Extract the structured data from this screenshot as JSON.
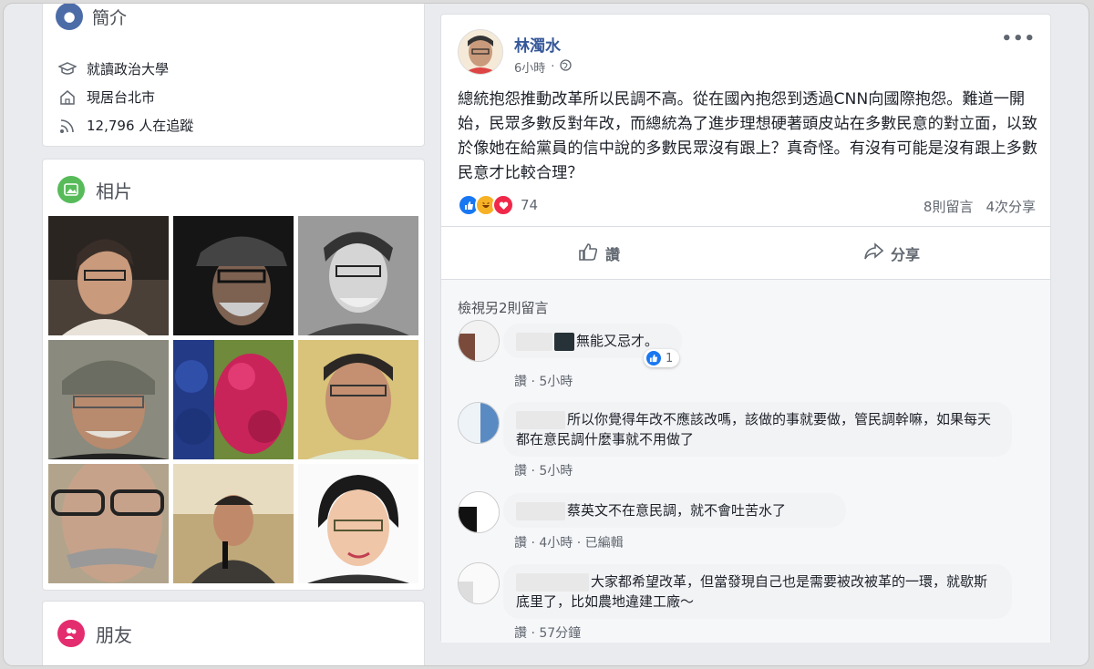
{
  "intro": {
    "title": "簡介",
    "education": "就讀政治大學",
    "residence": "現居台北市",
    "followers": "12,796 人在追蹤"
  },
  "photos": {
    "title": "相片"
  },
  "friends": {
    "title": "朋友"
  },
  "post": {
    "author": "林濁水",
    "time": "6小時",
    "text": "總統抱怨推動改革所以民調不高。從在國內抱怨到透過CNN向國際抱怨。難道一開始，民眾多數反對年改，而總統為了進步理想硬著頭皮站在多數民意的對立面，以致於像她在給黨員的信中說的多數民眾沒有跟上？真奇怪。有沒有可能是沒有跟上多數民意才比較合理？",
    "reaction_count": "74",
    "comment_count": "8則留言",
    "share_count": "4次分享",
    "like_label": "讚",
    "share_label": "分享",
    "more_icon": "more-dots-icon",
    "colors": {
      "link": "#365899",
      "like_blue": "#1877f2",
      "haha": "#f7b125",
      "love": "#f0284a"
    }
  },
  "comments": {
    "view_more": "檢視另2則留言",
    "items": [
      {
        "text": "無能又忌才。",
        "like": "讚",
        "time": "5小時",
        "reactions": "1"
      },
      {
        "text": "所以你覺得年改不應該改嗎，該做的事就要做，管民調幹嘛，如果每天都在意民調什麼事就不用做了",
        "like": "讚",
        "time": "5小時"
      },
      {
        "text": "蔡英文不在意民調，就不會吐苦水了",
        "like": "讚",
        "time": "4小時",
        "edited": "已編輯"
      },
      {
        "text": "大家都希望改革，但當發現自己也是需要被改被革的一環，就歇斯底里了，比如農地違建工廠～",
        "like": "讚",
        "time": "57分鐘"
      }
    ]
  }
}
